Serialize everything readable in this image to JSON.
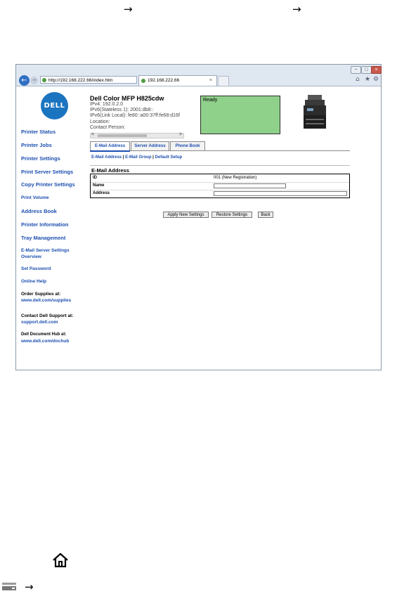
{
  "doc": {
    "arrow_glyph": "→"
  },
  "browser": {
    "address_url": "http://192.168.222.66/index.htm",
    "address_tools": "⌕ ▾ ↻",
    "tab_title": "192.168.222.66",
    "tab_close": "×",
    "back_glyph": "←",
    "forward_glyph": "→",
    "window_buttons": {
      "minimize": "−",
      "maximize": "□",
      "close": "×"
    },
    "toolbar_icons": {
      "home": "⌂",
      "favorites": "★",
      "tools": "⚙"
    }
  },
  "logo_text": "DELL",
  "sidebar": {
    "items": [
      {
        "label": "Printer Status"
      },
      {
        "label": "Printer Jobs"
      },
      {
        "label": "Printer Settings"
      },
      {
        "label": "Print Server Settings"
      },
      {
        "label": "Copy Printer Settings"
      },
      {
        "label": "Print Volume"
      },
      {
        "label": "Address Book"
      },
      {
        "label": "Printer Information"
      },
      {
        "label": "Tray Management"
      },
      {
        "label_line1": "E-Mail Server Settings",
        "label_line2": "Overview"
      },
      {
        "label": "Set Password"
      },
      {
        "label": "Online Help"
      }
    ],
    "order_supplies": {
      "label": "Order Supplies at:",
      "url": "www.dell.com/supplies"
    },
    "contact_support": {
      "label": "Contact Dell Support at:",
      "url": "support.dell.com"
    },
    "document_hub": {
      "label": "Dell Document Hub at:",
      "url": "www.dell.com/dochub"
    }
  },
  "device": {
    "name": "Dell Color MFP H825cdw",
    "ipv4": "IPv4: 192.0.2.0",
    "ipv6_stateless": "IPv6(Stateless 1): 2001:db8::",
    "ipv6_link_local": "IPv6(Link Local): fe80::a00:37ff:fe68:d16f",
    "location": "Location:",
    "contact_person": "Contact Person:",
    "scroll_left": "<",
    "scroll_right": ">"
  },
  "status_text": "Ready",
  "tabs": [
    {
      "label": "E-Mail Address",
      "active": true
    },
    {
      "label": "Server Address",
      "active": false
    },
    {
      "label": "Phone Book",
      "active": false
    }
  ],
  "sub_links": {
    "email_address": "E-Mail Address",
    "email_group": "E-Mail Group",
    "default_setup": "Default Setup",
    "separator": "|"
  },
  "section_title": "E-Mail Address",
  "form": {
    "id_label": "ID",
    "id_value": "001  (New Registration)",
    "name_label": "Name",
    "name_value": "",
    "address_label": "Address",
    "address_value": ""
  },
  "buttons": {
    "apply": "Apply New Settings",
    "restore": "Restore Settings",
    "back": "Back"
  }
}
